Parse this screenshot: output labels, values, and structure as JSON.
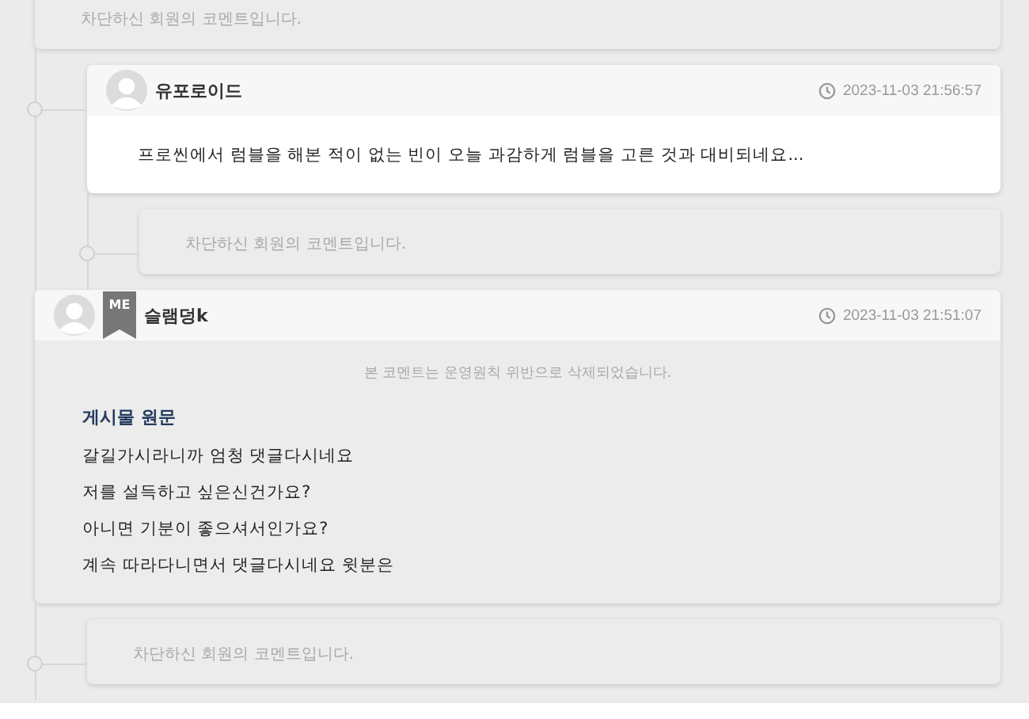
{
  "comments": [
    {
      "kind": "blocked",
      "text": "차단하신 회원의 코멘트입니다.",
      "children": [
        {
          "kind": "comment",
          "author": "유포로이드",
          "time": "2023-11-03 21:56:57",
          "deleted": false,
          "lines": [
            "프로씬에서 럼블을 해본 적이 없는 빈이 오늘 과감하게 럼블을 고른 것과 대비되네요..."
          ],
          "children": [
            {
              "kind": "blocked",
              "text": "차단하신 회원의 코멘트입니다."
            }
          ]
        }
      ]
    },
    {
      "kind": "comment",
      "author": "슬램덩k",
      "badge": "ME",
      "time": "2023-11-03 21:51:07",
      "deleted": true,
      "notice": "본 코멘트는 운영원칙 위반으로 삭제되었습니다.",
      "quote_title": "게시물 원문",
      "lines": [
        "갈길가시라니까 엄청 댓글다시네요",
        "저를 설득하고 싶은신건가요?",
        "아니면 기분이 좋으셔서인가요?",
        "계속 따라다니면서 댓글다시네요 윗분은"
      ],
      "children": [
        {
          "kind": "blocked",
          "text": "차단하신 회원의 코멘트입니다."
        }
      ]
    }
  ]
}
